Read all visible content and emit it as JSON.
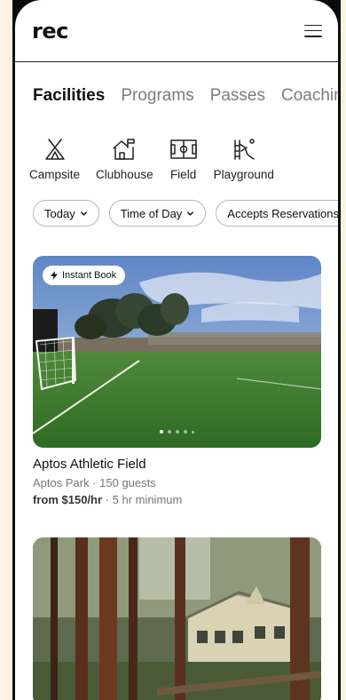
{
  "header": {
    "logo": "rec",
    "menu_icon": "hamburger-menu-icon"
  },
  "tabs": [
    {
      "label": "Facilities",
      "active": true
    },
    {
      "label": "Programs",
      "active": false
    },
    {
      "label": "Passes",
      "active": false
    },
    {
      "label": "Coaching",
      "active": false
    }
  ],
  "categories": [
    {
      "label": "Campsite",
      "icon": "tent-icon"
    },
    {
      "label": "Clubhouse",
      "icon": "clubhouse-icon"
    },
    {
      "label": "Field",
      "icon": "field-icon"
    },
    {
      "label": "Playground",
      "icon": "playground-icon"
    }
  ],
  "filters": [
    {
      "label": "Today"
    },
    {
      "label": "Time of Day"
    },
    {
      "label": "Accepts Reservations"
    }
  ],
  "listings": [
    {
      "badge": "Instant Book",
      "title": "Aptos Athletic Field",
      "subtitle": "Aptos Park · 150 guests",
      "price_bold": "from $150/hr",
      "price_rest": " · 5 hr minimum",
      "image_count": 5,
      "active_image": 1
    },
    {
      "title": ""
    }
  ],
  "colors": {
    "background": "#fbf3df",
    "text": "#111111",
    "muted": "#7d7d7d"
  }
}
